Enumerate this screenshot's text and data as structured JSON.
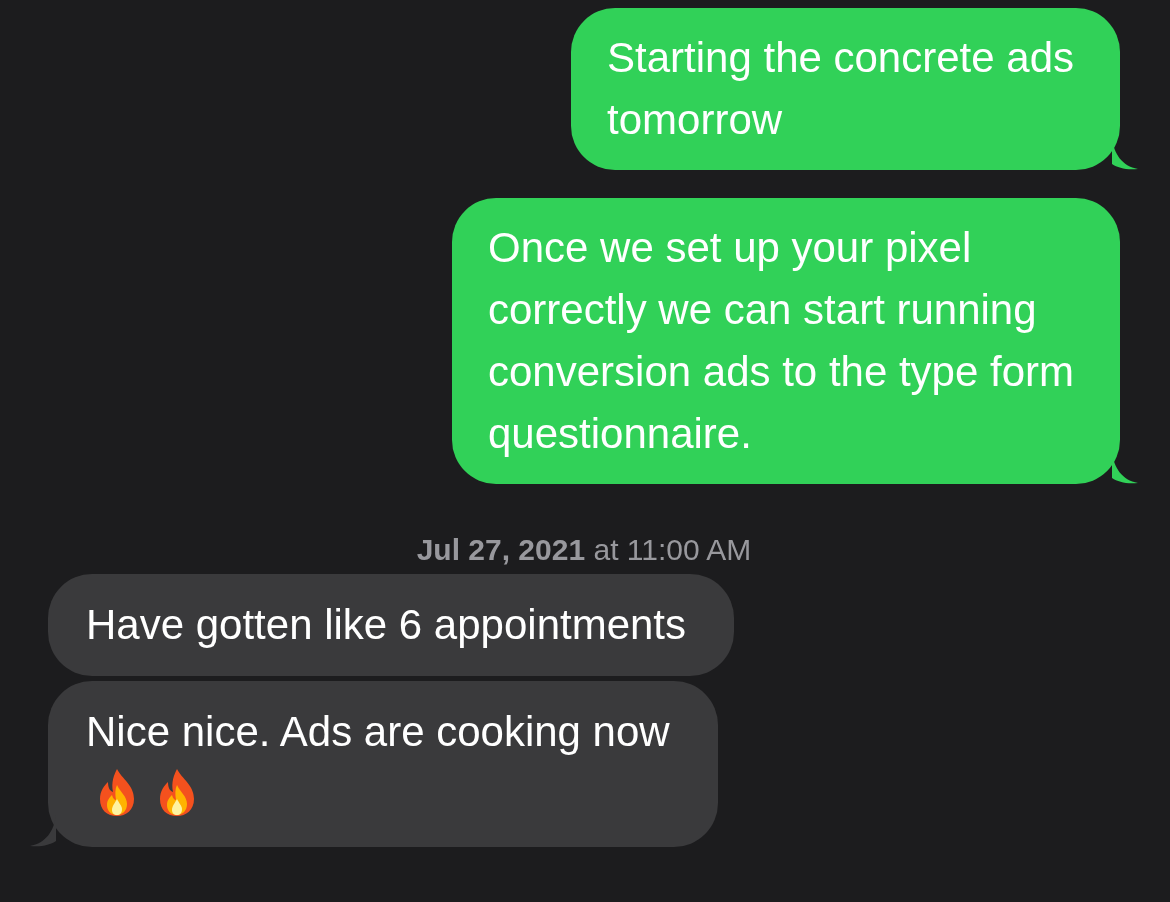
{
  "messages": [
    {
      "kind": "sent",
      "text": "Starting the concrete ads\ntomorrow",
      "tail": true
    },
    {
      "kind": "sent",
      "text": "Once we set up your pixel\ncorrectly we can start running\nconversion ads to the type form\nquestionnaire.",
      "tail": true
    },
    {
      "kind": "timestamp",
      "date": "Jul 27, 2021",
      "time": "at 11:00 AM"
    },
    {
      "kind": "received",
      "text": "Have gotten like 6 appointments",
      "tail": false
    },
    {
      "kind": "received",
      "text": "Nice nice. Ads are cooking now",
      "tail": true,
      "emojis": [
        {
          "kind": "fire"
        },
        {
          "kind": "fire"
        }
      ]
    }
  ]
}
